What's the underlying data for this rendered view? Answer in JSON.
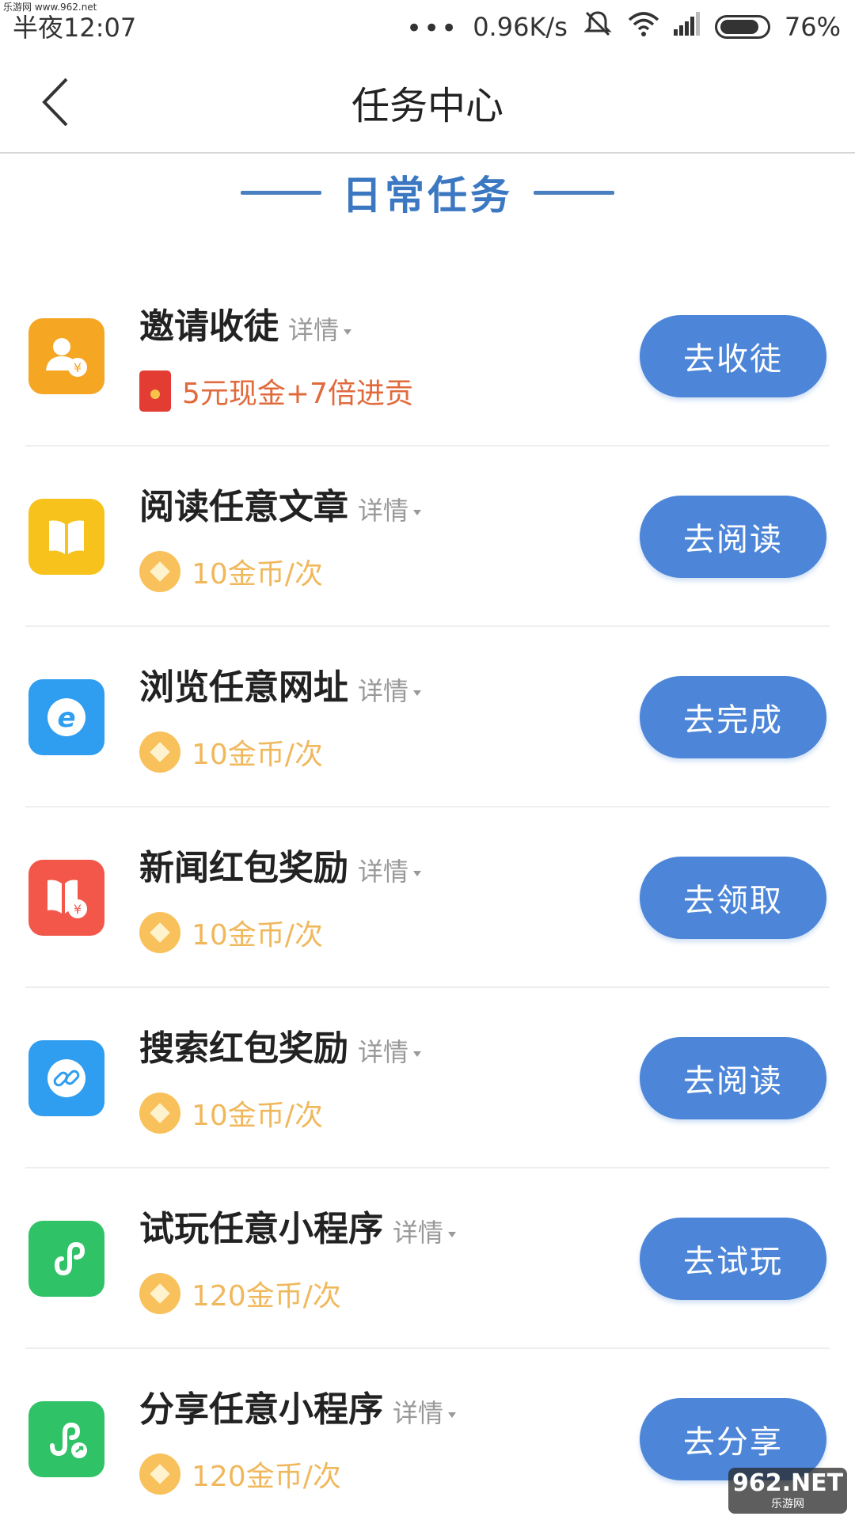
{
  "watermark": {
    "top": "乐游网 www.962.net",
    "logo": "962.NET",
    "logo_sub": "乐游网"
  },
  "status_bar": {
    "time": "半夜12:07",
    "dots": "•••",
    "speed": "0.96K/s",
    "battery_percent": "76%",
    "icons": [
      "mute-icon",
      "wifi-icon",
      "signal-icon",
      "battery-icon"
    ]
  },
  "header": {
    "title": "任务中心",
    "back_icon": "chevron-left-icon"
  },
  "section": {
    "title": "日常任务"
  },
  "colors": {
    "accent": "#4d86d8",
    "section": "#3c78c2",
    "coin": "#f8c15b",
    "reward_text": "#f0b85c",
    "cash_text": "#e16a3c"
  },
  "tasks": [
    {
      "name": "邀请收徒",
      "detail": "详情",
      "reward": "5元现金+7倍进贡",
      "reward_type": "cash",
      "button": "去收徒",
      "icon": "invite-user-icon",
      "icon_color": "#f5a623"
    },
    {
      "name": "阅读任意文章",
      "detail": "详情",
      "reward": "10金币/次",
      "reward_type": "coin",
      "button": "去阅读",
      "icon": "book-icon",
      "icon_color": "#f7c21c"
    },
    {
      "name": "浏览任意网址",
      "detail": "详情",
      "reward": "10金币/次",
      "reward_type": "coin",
      "button": "去完成",
      "icon": "browser-e-icon",
      "icon_color": "#2f9df0"
    },
    {
      "name": "新闻红包奖励",
      "detail": "详情",
      "reward": "10金币/次",
      "reward_type": "coin",
      "button": "去领取",
      "icon": "news-redpack-icon",
      "icon_color": "#f2574a"
    },
    {
      "name": "搜索红包奖励",
      "detail": "详情",
      "reward": "10金币/次",
      "reward_type": "coin",
      "button": "去阅读",
      "icon": "link-icon",
      "icon_color": "#2f9df0"
    },
    {
      "name": "试玩任意小程序",
      "detail": "详情",
      "reward": "120金币/次",
      "reward_type": "coin",
      "button": "去试玩",
      "icon": "mini-program-icon",
      "icon_color": "#2fc267"
    },
    {
      "name": "分享任意小程序",
      "detail": "详情",
      "reward": "120金币/次",
      "reward_type": "coin",
      "button": "去分享",
      "icon": "share-mini-program-icon",
      "icon_color": "#2fc267"
    }
  ]
}
